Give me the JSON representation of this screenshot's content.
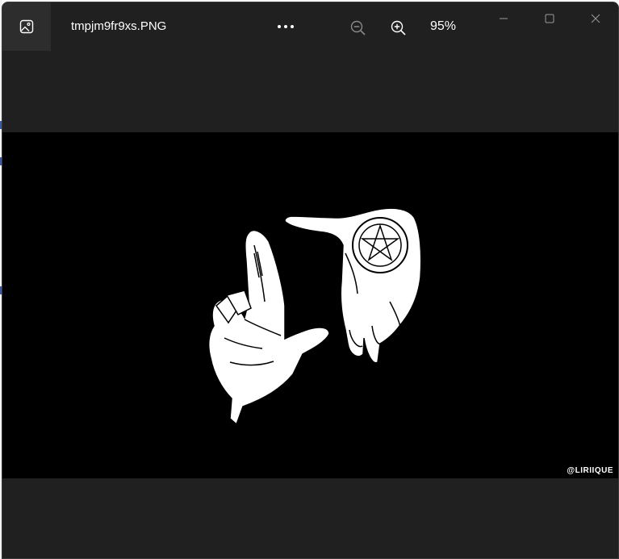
{
  "window": {
    "file_name": "tmpjm9fr9xs.PNG",
    "zoom_level": "95%"
  },
  "toolbar": {
    "app_icon": "image-icon",
    "more_icon": "more-options-icon",
    "zoom_out_icon": "zoom-out-icon",
    "zoom_in_icon": "zoom-in-icon"
  },
  "caption_buttons": {
    "minimize_icon": "minimize-icon",
    "maximize_icon": "maximize-icon",
    "close_icon": "close-icon"
  },
  "image": {
    "watermark": "@LIRIIQUE"
  },
  "colors": {
    "titlebar": "#202020",
    "canvas": "#000000",
    "foreground": "#ffffff"
  }
}
